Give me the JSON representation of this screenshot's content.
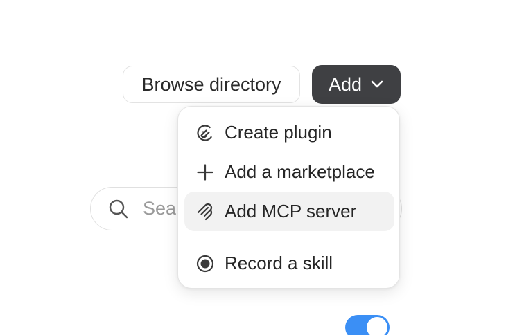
{
  "toolbar": {
    "browse_label": "Browse directory",
    "add_label": "Add"
  },
  "search": {
    "placeholder_visible": "Sear"
  },
  "add_menu": {
    "items": [
      {
        "label": "Create plugin",
        "icon": "plugin-icon"
      },
      {
        "label": "Add a marketplace",
        "icon": "plus-icon"
      },
      {
        "label": "Add MCP server",
        "icon": "mcp-server-icon",
        "highlighted": true
      },
      {
        "label": "Record a skill",
        "icon": "record-icon"
      }
    ]
  },
  "toggle": {
    "state": "on",
    "color": "#3b8ff5"
  },
  "colors": {
    "add_button_bg": "#3f4043",
    "menu_hover_bg": "#f2f2f2"
  }
}
